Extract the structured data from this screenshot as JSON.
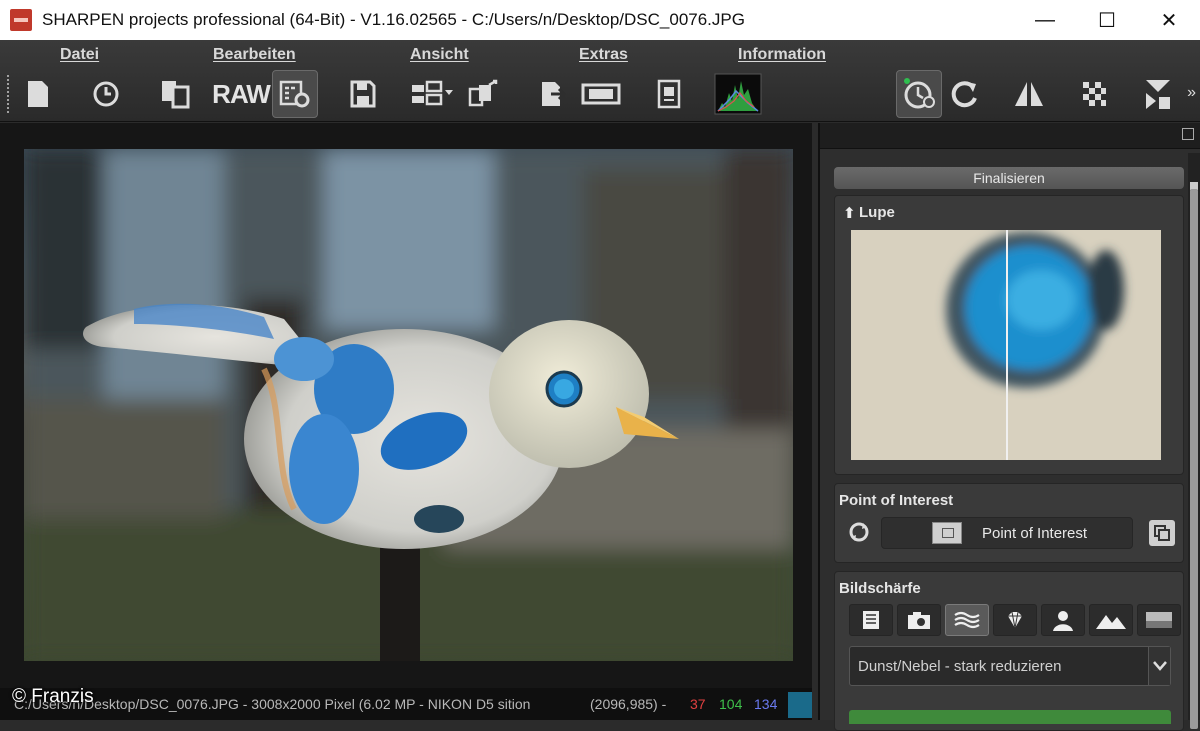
{
  "window": {
    "title": "SHARPEN projects professional (64-Bit) - V1.16.02565 - C:/Users/n/Desktop/DSC_0076.JPG",
    "controls": [
      "—",
      "☐",
      "✕"
    ]
  },
  "menu": {
    "items": [
      "Datei",
      "Bearbeiten",
      "Ansicht",
      "Extras",
      "Information"
    ]
  },
  "toolbar": {
    "raw_label": "RAW",
    "icons": [
      "new-file-icon",
      "history-icon",
      "copy-icon",
      "raw-icon",
      "settings-icon",
      "save-icon",
      "batch-icon",
      "export-icon",
      "import-icon",
      "filmstrip-icon",
      "document-icon",
      "histogram-icon",
      "timer-icon",
      "redo-icon",
      "mirror-icon",
      "pattern-icon",
      "cursor-icon"
    ],
    "more": "»"
  },
  "status": {
    "path": "C:/Users/n/Desktop/DSC_0076.JPG - 3008x2000 Pixel (6.02 MP  - NIKON D5  sition",
    "coords": "(2096,985) -",
    "r": "37",
    "g": "104",
    "b": "134",
    "swatch_color": "#1a6a8a"
  },
  "watermark": "© Franzis",
  "panel": {
    "finalize_label": "Finalisieren",
    "lupe": {
      "title": "Lupe"
    },
    "poi": {
      "title": "Point of Interest",
      "button_label": "Point of Interest"
    },
    "sharpness": {
      "title": "Bildschärfe",
      "presets": [
        "text-icon",
        "camera-icon",
        "haze-icon",
        "diamond-icon",
        "portrait-icon",
        "landscape-icon",
        "panorama-icon"
      ],
      "active_preset": 2,
      "dropdown_value": "Dunst/Nebel - stark reduzieren"
    }
  },
  "colors": {
    "accent_green": "#3f8a3b",
    "menu_text": "#d8d8d8"
  }
}
